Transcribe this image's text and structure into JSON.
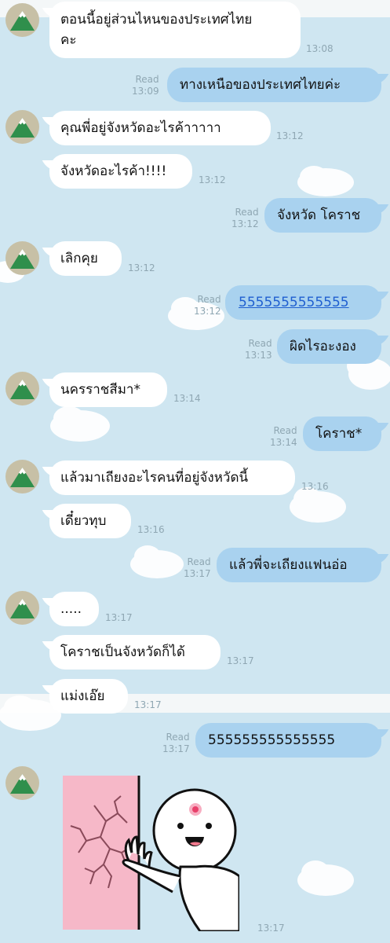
{
  "messages": [
    {
      "text": "ตอนนี้อยู่ส่วนไหนของประเทศไทย\nคะ",
      "time": "13:08"
    },
    {
      "text": "ทางเหนือของประเทศไทยค่ะ",
      "read": "Read",
      "time": "13:09"
    },
    {
      "text": "คุณพี่อยู่จังหวัดอะไรค้าาาาา",
      "time": "13:12"
    },
    {
      "text": "จังหวัดอะไรค้า!!!!",
      "time": "13:12"
    },
    {
      "text": "จังหวัด โคราช",
      "read": "Read",
      "time": "13:12"
    },
    {
      "text": "เลิกคุย",
      "time": "13:12"
    },
    {
      "text": "5555555555555",
      "read": "Read",
      "time": "13:12"
    },
    {
      "text": "ผิดไรอะงอง",
      "read": "Read",
      "time": "13:13"
    },
    {
      "text": "นครราชสีมา*",
      "time": "13:14"
    },
    {
      "text": "โคราช*",
      "read": "Read",
      "time": "13:14"
    },
    {
      "text": "แล้วมาเถียงอะไรคนที่อยู่จังหวัดนี้",
      "time": "13:16"
    },
    {
      "text": "เดี๋ยวทุบ",
      "time": "13:16"
    },
    {
      "text": "แล้วพี่จะเถียงแฟนอ่อ",
      "read": "Read",
      "time": "13:17"
    },
    {
      "text": ".....",
      "time": "13:17"
    },
    {
      "text": "โคราชเป็นจังหวัดก็ได้",
      "time": "13:17"
    },
    {
      "text": "แม่งเอ๊ย",
      "time": "13:17"
    },
    {
      "text": "555555555555555",
      "read": "Read",
      "time": "13:17"
    },
    {
      "sticker": "laughing-stick-figure-wall-punch",
      "time": "13:17"
    }
  ],
  "colors": {
    "background": "#cfe6f1",
    "incoming_bubble": "#ffffff",
    "outgoing_bubble": "#a9d2ef",
    "meta_text": "#8fa7b3",
    "link": "#1f5fd0"
  }
}
